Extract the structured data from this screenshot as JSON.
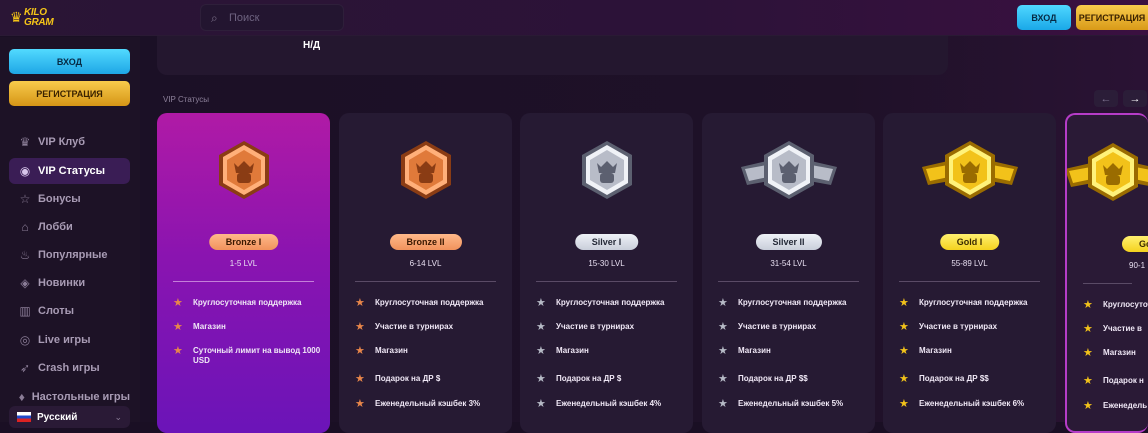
{
  "header": {
    "logo_text": "KILO GRAM",
    "search_placeholder": "Поиск",
    "login_label": "ВХОД",
    "register_label": "РЕГИСТРАЦИЯ"
  },
  "sidebar": {
    "login_label": "ВХОД",
    "register_label": "РЕГИСТРАЦИЯ",
    "items": [
      {
        "label": "VIP Клуб",
        "icon": "crown-icon",
        "glyph": "♛",
        "active": false
      },
      {
        "label": "VIP Статусы",
        "icon": "vip-icon",
        "glyph": "◉",
        "active": true
      },
      {
        "label": "Бонусы",
        "icon": "star-icon",
        "glyph": "☆",
        "active": false
      },
      {
        "label": "Лобби",
        "icon": "home-icon",
        "glyph": "⌂",
        "active": false
      },
      {
        "label": "Популярные",
        "icon": "fire-icon",
        "glyph": "♨",
        "active": false
      },
      {
        "label": "Новинки",
        "icon": "tag-icon",
        "glyph": "◈",
        "active": false
      },
      {
        "label": "Слоты",
        "icon": "slots-icon",
        "glyph": "▥",
        "active": false
      },
      {
        "label": "Live игры",
        "icon": "live-icon",
        "glyph": "◎",
        "active": false
      },
      {
        "label": "Crash игры",
        "icon": "rocket-icon",
        "glyph": "➶",
        "active": false
      },
      {
        "label": "Настольные игры",
        "icon": "cards-icon",
        "glyph": "♦",
        "active": false
      }
    ],
    "language": "Русский"
  },
  "main": {
    "prev_value": "Н/Д",
    "section_title": "VIP Статусы",
    "cards": [
      {
        "name": "Bronze I",
        "level": "1-5 LVL",
        "tier": "bronze",
        "features": [
          "Круглосуточная поддержка",
          "Магазин",
          "Суточный лимит на вывод 1000 USD"
        ]
      },
      {
        "name": "Bronze II",
        "level": "6-14 LVL",
        "tier": "bronze",
        "features": [
          "Круглосуточная поддержка",
          "Участие в турнирах",
          "Магазин",
          "Подарок на ДР $",
          "Еженедельный кэшбек 3%"
        ]
      },
      {
        "name": "Silver I",
        "level": "15-30 LVL",
        "tier": "silver",
        "features": [
          "Круглосуточная поддержка",
          "Участие в турнирах",
          "Магазин",
          "Подарок на ДР $",
          "Еженедельный кэшбек 4%"
        ]
      },
      {
        "name": "Silver II",
        "level": "31-54 LVL",
        "tier": "silver",
        "features": [
          "Круглосуточная поддержка",
          "Участие в турнирах",
          "Магазин",
          "Подарок на ДР $$",
          "Еженедельный кэшбек 5%"
        ]
      },
      {
        "name": "Gold I",
        "level": "55-89 LVL",
        "tier": "gold",
        "features": [
          "Круглосуточная поддержка",
          "Участие в турнирах",
          "Магазин",
          "Подарок на ДР $$",
          "Еженедельный кэшбек 6%"
        ]
      },
      {
        "name": "Go",
        "level": "90-1",
        "tier": "gold",
        "features": [
          "Круглосуточная",
          "Участие в",
          "Магазин",
          "Подарок н",
          "Еженедель"
        ]
      }
    ]
  },
  "colors": {
    "bronze": "#e07a3a",
    "silver": "#b8bcc8",
    "gold": "#f2c21a",
    "accent_blue": "#1ea6e6",
    "accent_gold": "#f8cb4c"
  }
}
